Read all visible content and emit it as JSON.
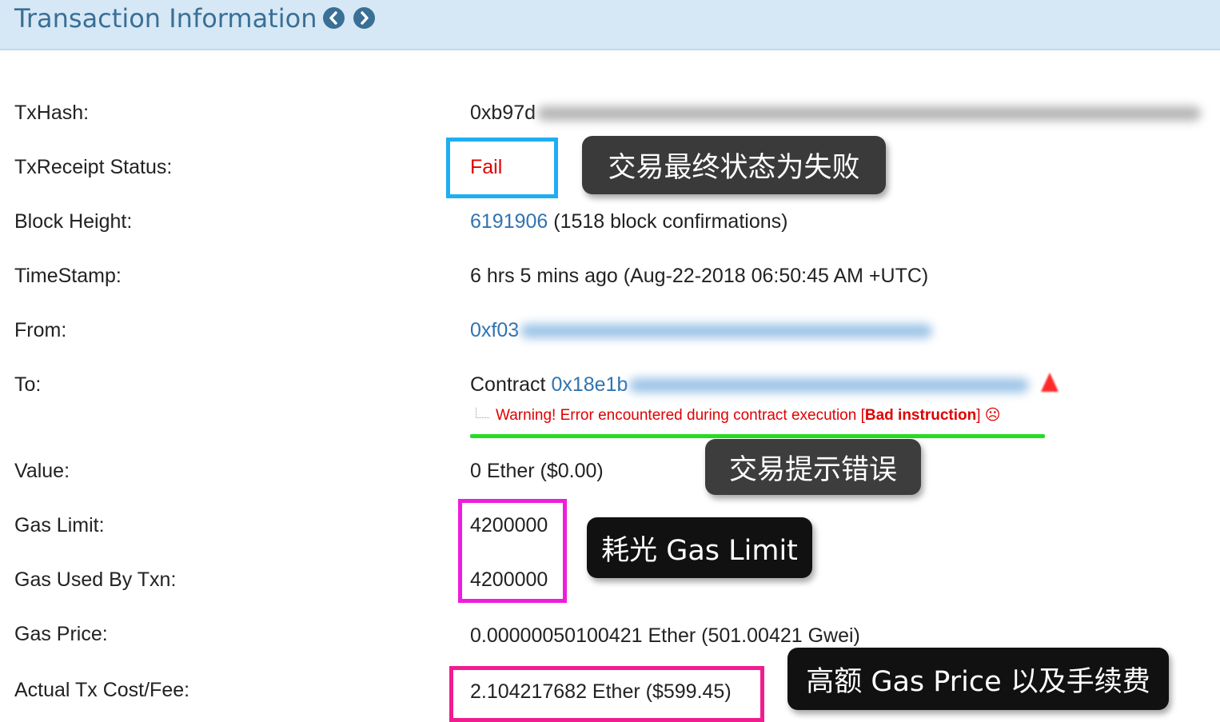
{
  "header": {
    "title": "Transaction Information",
    "prev_icon": "chevron-left-circle-icon",
    "next_icon": "chevron-right-circle-icon"
  },
  "colors": {
    "link": "#3173b0",
    "fail": "#e00000",
    "header_bg": "#d6e8f5",
    "header_text": "#3a6f96",
    "highlight_blue": "#1eaef2",
    "highlight_magenta": "#ee1cdd",
    "highlight_pink": "#f01c90",
    "underline_green": "#22dd22"
  },
  "fields": {
    "txhash": {
      "label": "TxHash:",
      "value": "0xb97d"
    },
    "status": {
      "label": "TxReceipt Status:",
      "value": "Fail"
    },
    "block": {
      "label": "Block Height:",
      "number": "6191906",
      "confirmations": " (1518 block confirmations)"
    },
    "timestamp": {
      "label": "TimeStamp:",
      "value": "6 hrs 5 mins ago (Aug-22-2018 06:50:45 AM +UTC)"
    },
    "from": {
      "label": "From:",
      "value": "0xf03"
    },
    "to": {
      "label": "To:",
      "prefix": "Contract ",
      "address": "0x18e1b",
      "warning_text": "Warning! Error encountered during contract execution [",
      "warning_bold": "Bad instruction",
      "warning_end": "] ☹"
    },
    "value": {
      "label": "Value:",
      "value": "0 Ether ($0.00)"
    },
    "gas_limit": {
      "label": "Gas Limit:",
      "value": "4200000"
    },
    "gas_used": {
      "label": "Gas Used By Txn:",
      "value": "4200000"
    },
    "gas_price": {
      "label": "Gas Price:",
      "value": "0.00000050100421 Ether (501.00421 Gwei)"
    },
    "fee": {
      "label": "Actual Tx Cost/Fee:",
      "value": "2.104217682 Ether ($599.45)"
    }
  },
  "annotations": {
    "status_note": "交易最终状态为失败",
    "error_note": "交易提示错误",
    "gas_note": "耗光 Gas Limit",
    "price_note": "高额 Gas Price 以及手续费"
  }
}
